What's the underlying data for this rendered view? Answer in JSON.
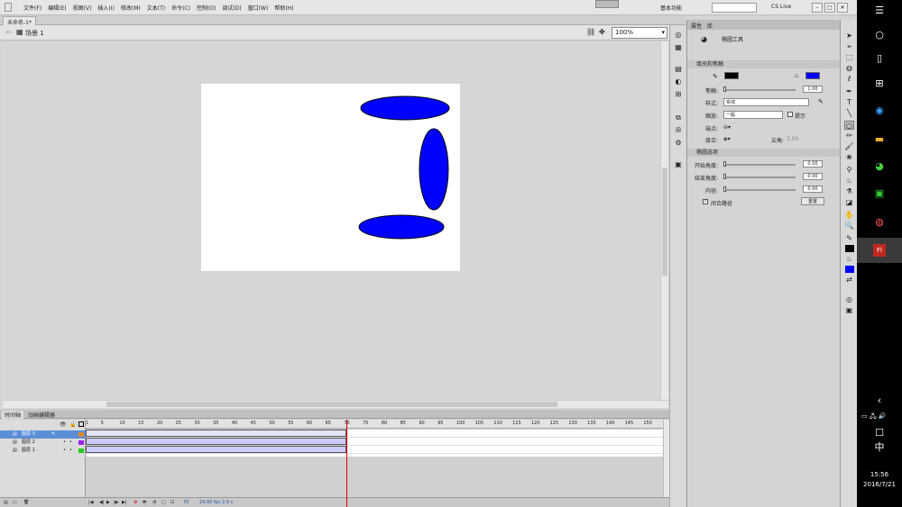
{
  "menubar": {
    "items": [
      "文件(F)",
      "编辑(E)",
      "视图(V)",
      "插入(I)",
      "修改(M)",
      "文本(T)",
      "命令(C)",
      "控制(O)",
      "调试(D)",
      "窗口(W)",
      "帮助(H)"
    ],
    "workspace": "基本功能",
    "cs_live": "CS Live"
  },
  "document": {
    "tab": "未命名-1*",
    "scene": "场景 1",
    "zoom": "100%"
  },
  "properties": {
    "tab_properties": "属性",
    "tab_library": "库",
    "tool_name": "椭圆工具",
    "section_fill_stroke": "填充和笔触",
    "stroke_color": "#000000",
    "fill_color": "#0000ff",
    "stroke_label": "笔触:",
    "stroke_value": "1.00",
    "style_label": "样式:",
    "style_value": "实线",
    "scale_label": "缩放:",
    "scale_value": "一般",
    "hint_label": "提示",
    "cap_label": "端点:",
    "join_label": "接合:",
    "miter_label": "尖角:",
    "miter_value": "3.00",
    "section_ellipse": "椭圆选项",
    "start_angle_label": "开始角度:",
    "start_angle_value": "0.00",
    "end_angle_label": "结束角度:",
    "end_angle_value": "0.00",
    "inner_radius_label": "内径:",
    "inner_radius_value": "0.00",
    "close_path_label": "闭合路径",
    "reset_label": "重置"
  },
  "timeline": {
    "tab_timeline": "时间轴",
    "tab_motion_editor": "动画编辑器",
    "ruler_marks": [
      "1",
      "5",
      "10",
      "15",
      "20",
      "25",
      "30",
      "35",
      "40",
      "45",
      "50",
      "55",
      "60",
      "65",
      "70",
      "75",
      "80",
      "85",
      "90",
      "95",
      "100",
      "105",
      "110",
      "115",
      "120",
      "125",
      "130",
      "135",
      "140",
      "145",
      "150"
    ],
    "layers": [
      {
        "name": "图层 3",
        "color": "#e08a2c"
      },
      {
        "name": "图层 2",
        "color": "#a020f0"
      },
      {
        "name": "图层 1",
        "color": "#22cc22"
      }
    ],
    "current_frame": "70",
    "fps": "24.00 fps",
    "elapsed": "2.9 s"
  },
  "stage": {
    "background": "#ffffff",
    "shape_fill": "#0000ff"
  },
  "taskbar": {
    "time": "15:56",
    "date": "2016/7/21",
    "ime": "中"
  }
}
